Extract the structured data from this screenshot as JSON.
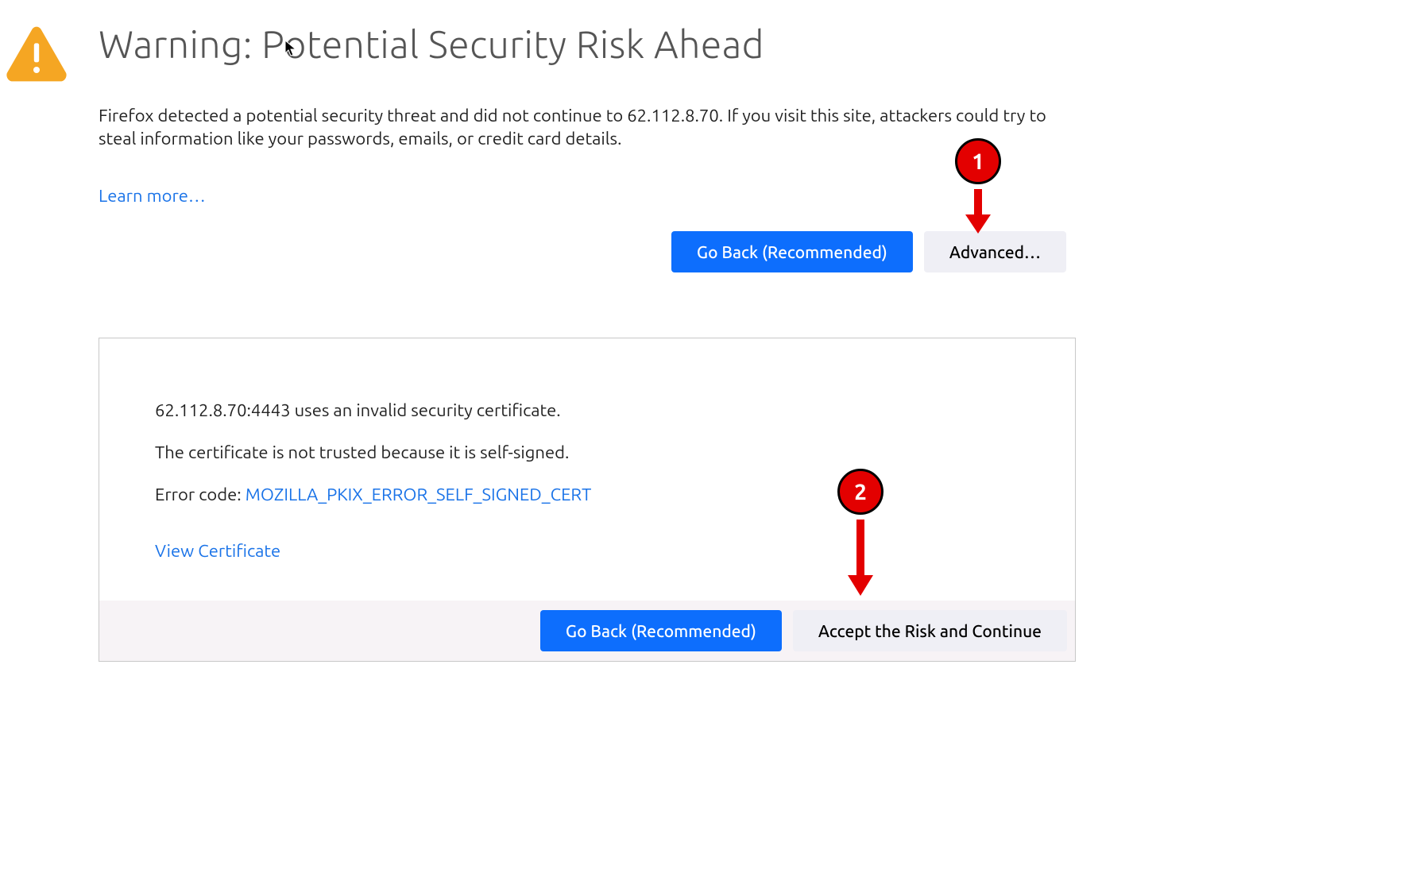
{
  "header": {
    "title": "Warning: Potential Security Risk Ahead"
  },
  "description": "Firefox detected a potential security threat and did not continue to 62.112.8.70. If you visit this site, attackers could try to steal information like your passwords, emails, or credit card details.",
  "learn_more": "Learn more…",
  "buttons": {
    "go_back": "Go Back (Recommended)",
    "advanced": "Advanced…",
    "accept": "Accept the Risk and Continue"
  },
  "advanced": {
    "line1": "62.112.8.70:4443 uses an invalid security certificate.",
    "line2": "The certificate is not trusted because it is self-signed.",
    "error_label": "Error code: ",
    "error_code": "MOZILLA_PKIX_ERROR_SELF_SIGNED_CERT",
    "view_cert": "View Certificate"
  },
  "callouts": {
    "one": "1",
    "two": "2"
  }
}
